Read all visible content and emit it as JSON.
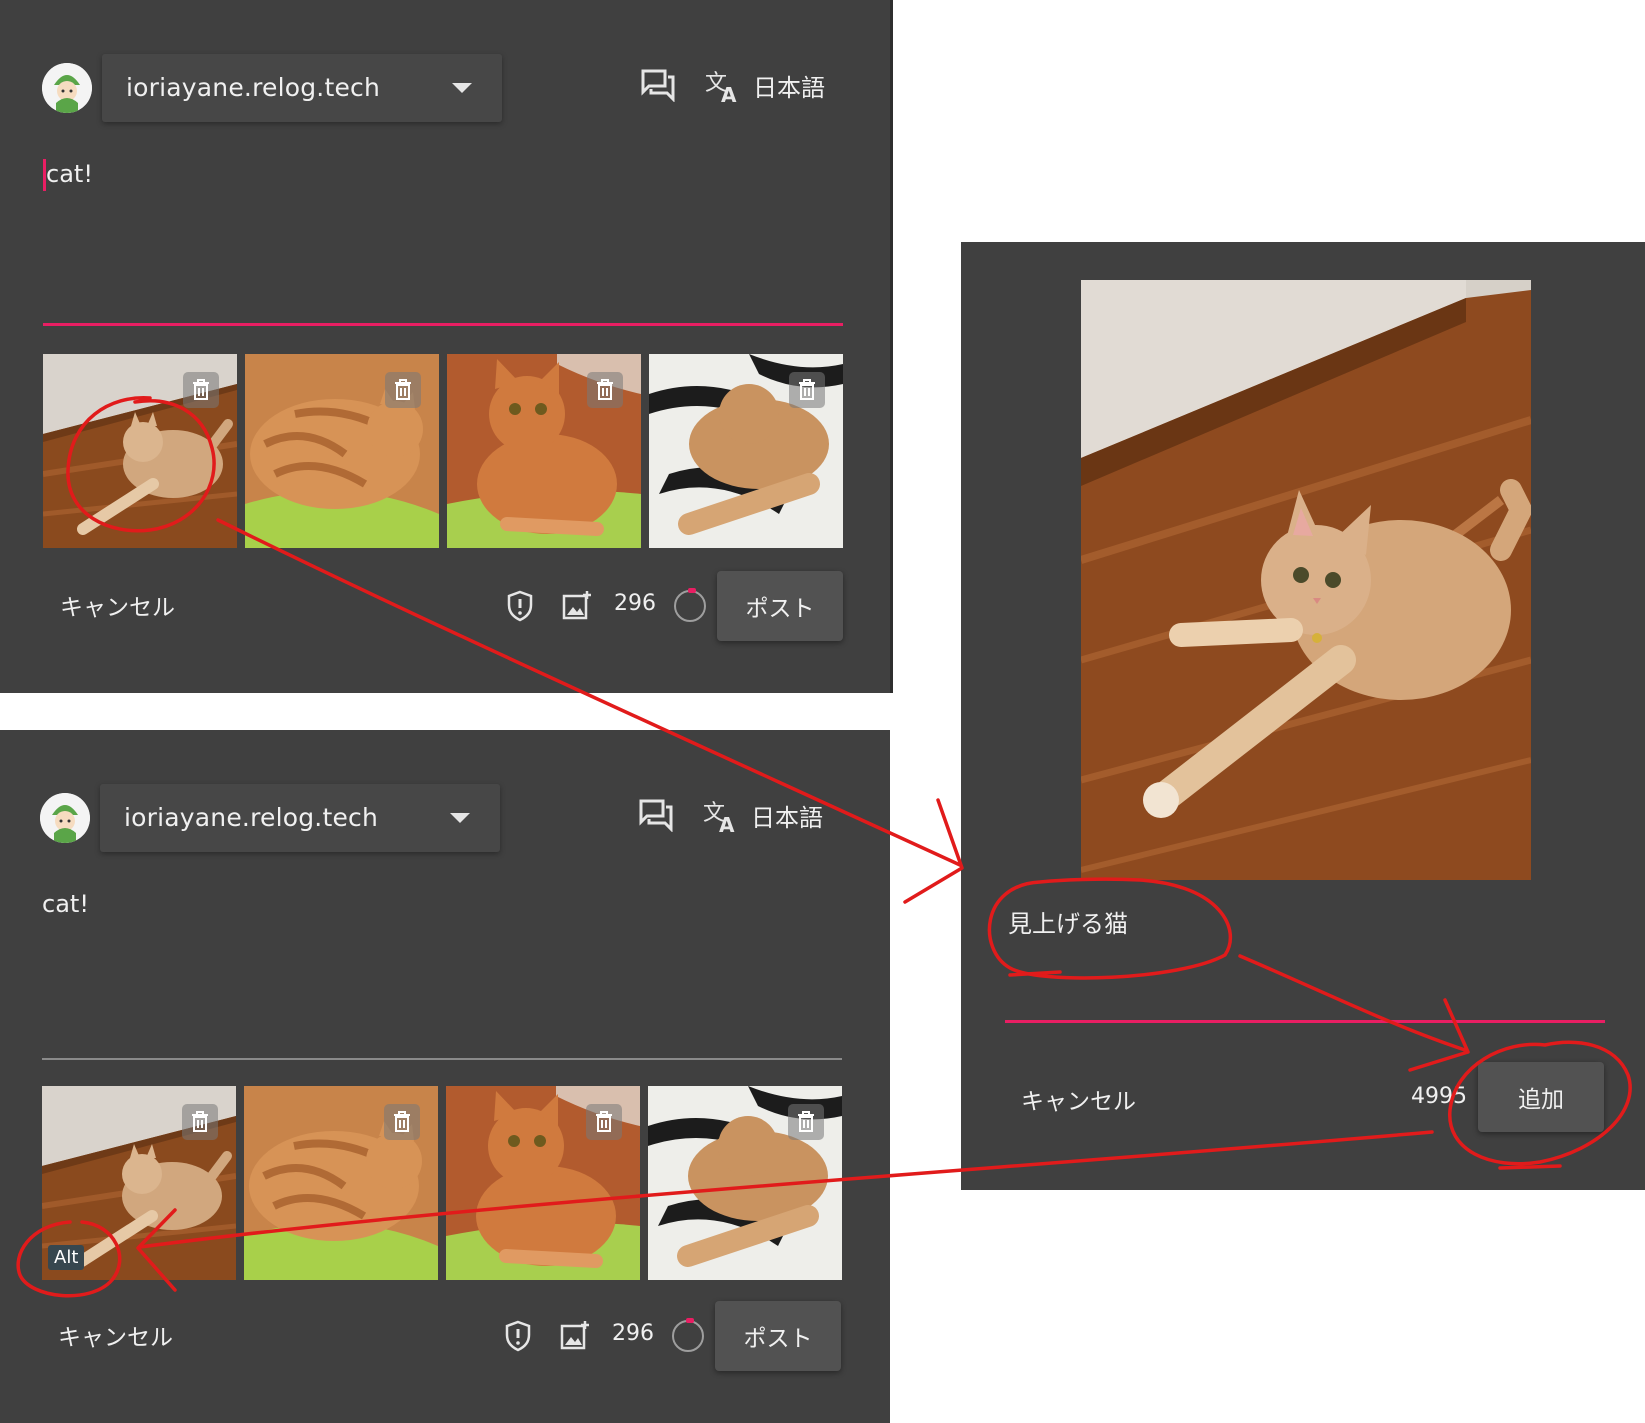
{
  "composer_top": {
    "account": "ioriayane.relog.tech",
    "icons": [
      "thread-icon",
      "translate-icon"
    ],
    "language": "日本語",
    "text": "cat!",
    "thumbnails": [
      {
        "name": "cat-looking-up",
        "alt": ""
      },
      {
        "name": "cat-sleeping-towel",
        "alt": ""
      },
      {
        "name": "cat-sitting",
        "alt": ""
      },
      {
        "name": "cat-on-zebra-blanket",
        "alt": ""
      }
    ],
    "cancel_label": "キャンセル",
    "remaining": "296",
    "post_label": "ポスト"
  },
  "composer_bottom": {
    "account": "ioriayane.relog.tech",
    "language": "日本語",
    "text": "cat!",
    "alt_badge": "Alt",
    "cancel_label": "キャンセル",
    "remaining": "296",
    "post_label": "ポスト"
  },
  "alt_dialog": {
    "alt_text": "見上げる猫",
    "cancel_label": "キャンセル",
    "remaining": "4995",
    "add_label": "追加"
  },
  "colors": {
    "panel_bg": "#404040",
    "accent": "#e91e63",
    "annotation": "#e11b1b"
  }
}
